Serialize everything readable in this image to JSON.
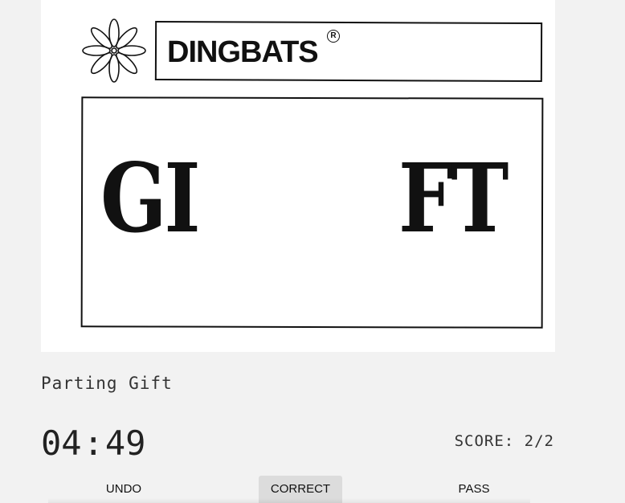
{
  "card": {
    "brand": "DINGBATS",
    "registered_mark": "R",
    "puzzle_left": "GI",
    "puzzle_right": "FT",
    "logo_icon": "flower-icon"
  },
  "answer": "Parting Gift",
  "timer": {
    "minutes": "04",
    "separator": ":",
    "seconds": "49"
  },
  "score": {
    "text": "SCORE: 2/2"
  },
  "controls": {
    "undo": "UNDO",
    "correct": "CORRECT",
    "pass": "PASS"
  },
  "colors": {
    "background": "#f2f2f2",
    "card": "#ffffff",
    "ink": "#111111",
    "active_button": "#dcdcdc"
  }
}
